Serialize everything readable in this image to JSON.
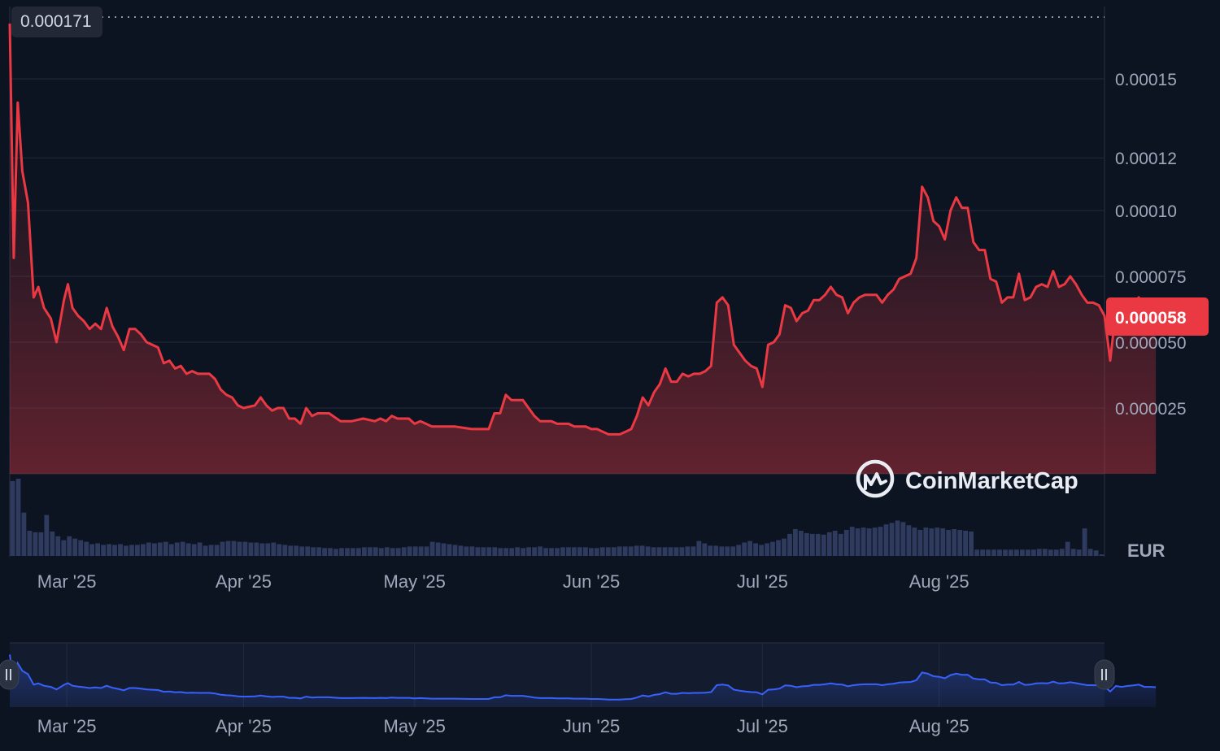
{
  "currency": "EUR",
  "watermark": "CoinMarketCap",
  "high_label": "0.000171",
  "current_label": "0.000058",
  "colors": {
    "background": "#0d1421",
    "price_line": "#ea3943",
    "current_badge": "#ea3943",
    "volume_bar": "#2e3a5e",
    "navigator_line": "#3861fb",
    "grid": "#222a3a"
  },
  "chart_data": {
    "type": "line",
    "ylim": [
      0,
      0.000175
    ],
    "y_ticks": [
      {
        "value": 2.5e-05,
        "label": "0.000025"
      },
      {
        "value": 5e-05,
        "label": "0.000050"
      },
      {
        "value": 7.5e-05,
        "label": "0.000075"
      },
      {
        "value": 0.0001,
        "label": "0.00010"
      },
      {
        "value": 0.00012,
        "label": "0.00012"
      },
      {
        "value": 0.00015,
        "label": "0.00015"
      }
    ],
    "x_ticks": [
      {
        "date": "2025-03-01",
        "label": "Mar '25"
      },
      {
        "date": "2025-04-01",
        "label": "Apr '25"
      },
      {
        "date": "2025-05-01",
        "label": "May '25"
      },
      {
        "date": "2025-06-01",
        "label": "Jun '25"
      },
      {
        "date": "2025-07-01",
        "label": "Jul '25"
      },
      {
        "date": "2025-08-01",
        "label": "Aug '25"
      }
    ],
    "start_date": "2025-02-19",
    "end_date": "2025-08-30",
    "series": [
      {
        "values": [
          [
            0,
            0.000171
          ],
          [
            0.7,
            8.2e-05
          ],
          [
            1.4,
            0.000141
          ],
          [
            2.2,
            0.000115
          ],
          [
            3.2,
            0.000103
          ],
          [
            4.2,
            6.7e-05
          ],
          [
            5,
            7.1e-05
          ],
          [
            6,
            6.3e-05
          ],
          [
            7.2,
            5.9e-05
          ],
          [
            8.2,
            5e-05
          ],
          [
            9.5,
            6.6e-05
          ],
          [
            10.2,
            7.2e-05
          ],
          [
            11,
            6.3e-05
          ],
          [
            12,
            6e-05
          ],
          [
            13,
            5.8e-05
          ],
          [
            14,
            5.5e-05
          ],
          [
            15,
            5.7e-05
          ],
          [
            16,
            5.5e-05
          ],
          [
            17,
            6.3e-05
          ],
          [
            18,
            5.6e-05
          ],
          [
            19,
            5.2e-05
          ],
          [
            20,
            4.7e-05
          ],
          [
            21,
            5.5e-05
          ],
          [
            22,
            5.5e-05
          ],
          [
            23,
            5.3e-05
          ],
          [
            24,
            5e-05
          ],
          [
            26,
            4.8e-05
          ],
          [
            27,
            4.2e-05
          ],
          [
            28,
            4.3e-05
          ],
          [
            29,
            4e-05
          ],
          [
            30,
            4.1e-05
          ],
          [
            31,
            3.8e-05
          ],
          [
            32,
            3.9e-05
          ],
          [
            33,
            3.8e-05
          ],
          [
            35,
            3.8e-05
          ],
          [
            36,
            3.6e-05
          ],
          [
            37,
            3.2e-05
          ],
          [
            38,
            3e-05
          ],
          [
            39,
            2.9e-05
          ],
          [
            40,
            2.6e-05
          ],
          [
            41,
            2.5e-05
          ],
          [
            43,
            2.6e-05
          ],
          [
            44,
            2.9e-05
          ],
          [
            45,
            2.6e-05
          ],
          [
            46,
            2.4e-05
          ],
          [
            47,
            2.5e-05
          ],
          [
            48,
            2.5e-05
          ],
          [
            49,
            2.1e-05
          ],
          [
            50,
            2.1e-05
          ],
          [
            51,
            1.9e-05
          ],
          [
            52,
            2.5e-05
          ],
          [
            53,
            2.2e-05
          ],
          [
            54,
            2.3e-05
          ],
          [
            56,
            2.3e-05
          ],
          [
            58,
            2e-05
          ],
          [
            60,
            2e-05
          ],
          [
            62,
            2.1e-05
          ],
          [
            64,
            2e-05
          ],
          [
            65,
            2.1e-05
          ],
          [
            66,
            2e-05
          ],
          [
            67,
            2.2e-05
          ],
          [
            68,
            2.1e-05
          ],
          [
            69,
            2.1e-05
          ],
          [
            70,
            2.1e-05
          ],
          [
            71,
            1.9e-05
          ],
          [
            72,
            2e-05
          ],
          [
            73,
            1.9e-05
          ],
          [
            74,
            1.8e-05
          ],
          [
            78,
            1.8e-05
          ],
          [
            81,
            1.7e-05
          ],
          [
            82,
            1.7e-05
          ],
          [
            84,
            1.7e-05
          ],
          [
            85,
            2.3e-05
          ],
          [
            86,
            2.3e-05
          ],
          [
            87,
            3e-05
          ],
          [
            88,
            2.8e-05
          ],
          [
            89,
            2.8e-05
          ],
          [
            90,
            2.8e-05
          ],
          [
            91,
            2.5e-05
          ],
          [
            92,
            2.2e-05
          ],
          [
            93,
            2e-05
          ],
          [
            94,
            2e-05
          ],
          [
            95,
            2e-05
          ],
          [
            96,
            1.9e-05
          ],
          [
            97,
            1.9e-05
          ],
          [
            98,
            1.9e-05
          ],
          [
            99,
            1.8e-05
          ],
          [
            100,
            1.8e-05
          ],
          [
            101,
            1.8e-05
          ],
          [
            102,
            1.7e-05
          ],
          [
            103,
            1.7e-05
          ],
          [
            104,
            1.6e-05
          ],
          [
            105,
            1.5e-05
          ],
          [
            106,
            1.5e-05
          ],
          [
            107,
            1.5e-05
          ],
          [
            108,
            1.6e-05
          ],
          [
            109,
            1.7e-05
          ],
          [
            110,
            2.2e-05
          ],
          [
            111,
            2.9e-05
          ],
          [
            112,
            2.6e-05
          ],
          [
            113,
            3.1e-05
          ],
          [
            114,
            3.4e-05
          ],
          [
            115,
            4e-05
          ],
          [
            116,
            3.5e-05
          ],
          [
            117,
            3.5e-05
          ],
          [
            118,
            3.8e-05
          ],
          [
            119,
            3.7e-05
          ],
          [
            120,
            3.8e-05
          ],
          [
            121,
            3.8e-05
          ],
          [
            122,
            3.9e-05
          ],
          [
            123,
            4.1e-05
          ],
          [
            124,
            6.5e-05
          ],
          [
            125,
            6.7e-05
          ],
          [
            126,
            6.4e-05
          ],
          [
            127,
            4.9e-05
          ],
          [
            128,
            4.6e-05
          ],
          [
            129,
            4.3e-05
          ],
          [
            130,
            4.1e-05
          ],
          [
            131,
            4e-05
          ],
          [
            132,
            3.3e-05
          ],
          [
            133,
            4.9e-05
          ],
          [
            134,
            5e-05
          ],
          [
            135,
            5.3e-05
          ],
          [
            136,
            6.4e-05
          ],
          [
            137,
            6.3e-05
          ],
          [
            138,
            5.8e-05
          ],
          [
            139,
            6.1e-05
          ],
          [
            140,
            6.2e-05
          ],
          [
            141,
            6.6e-05
          ],
          [
            142,
            6.6e-05
          ],
          [
            143,
            6.8e-05
          ],
          [
            144,
            7.1e-05
          ],
          [
            145,
            6.8e-05
          ],
          [
            146,
            6.7e-05
          ],
          [
            147,
            6.1e-05
          ],
          [
            148,
            6.5e-05
          ],
          [
            149,
            6.7e-05
          ],
          [
            150,
            6.8e-05
          ],
          [
            151,
            6.8e-05
          ],
          [
            152,
            6.8e-05
          ],
          [
            153,
            6.5e-05
          ],
          [
            154,
            6.8e-05
          ],
          [
            155,
            7e-05
          ],
          [
            156,
            7.4e-05
          ],
          [
            157,
            7.5e-05
          ],
          [
            158,
            7.6e-05
          ],
          [
            159,
            8.2e-05
          ],
          [
            160,
            0.000109
          ],
          [
            161,
            0.000105
          ],
          [
            162,
            9.6e-05
          ],
          [
            163,
            9.4e-05
          ],
          [
            164,
            8.9e-05
          ],
          [
            165,
            0.0001
          ],
          [
            166,
            0.000105
          ],
          [
            167,
            0.000101
          ],
          [
            168,
            0.000101
          ],
          [
            169,
            8.8e-05
          ],
          [
            170,
            8.5e-05
          ],
          [
            171,
            8.5e-05
          ],
          [
            172,
            7.4e-05
          ],
          [
            173,
            7.3e-05
          ],
          [
            174,
            6.5e-05
          ],
          [
            175,
            6.7e-05
          ],
          [
            176,
            6.7e-05
          ],
          [
            177,
            7.6e-05
          ],
          [
            178,
            6.6e-05
          ],
          [
            179,
            6.7e-05
          ],
          [
            180,
            7.1e-05
          ],
          [
            181,
            7.2e-05
          ],
          [
            182,
            7.1e-05
          ],
          [
            183,
            7.7e-05
          ],
          [
            184,
            7.1e-05
          ],
          [
            185,
            7.2e-05
          ],
          [
            186,
            7.5e-05
          ],
          [
            187,
            7.2e-05
          ],
          [
            188,
            6.8e-05
          ],
          [
            189,
            6.5e-05
          ],
          [
            190,
            6.5e-05
          ],
          [
            191,
            6.4e-05
          ],
          [
            192,
            6e-05
          ],
          [
            193,
            4.3e-05
          ],
          [
            194,
            6.2e-05
          ],
          [
            195,
            5.9e-05
          ],
          [
            196,
            6.2e-05
          ],
          [
            197,
            6.4e-05
          ],
          [
            198,
            6.7e-05
          ],
          [
            199,
            5.9e-05
          ],
          [
            200,
            5.9e-05
          ],
          [
            201,
            5.8e-05
          ]
        ]
      }
    ],
    "volume": [
      95,
      98,
      55,
      32,
      30,
      30,
      52,
      31,
      25,
      20,
      25,
      22,
      20,
      18,
      15,
      16,
      14,
      15,
      14,
      15,
      13,
      14,
      14,
      15,
      17,
      16,
      17,
      18,
      15,
      17,
      18,
      16,
      15,
      17,
      13,
      14,
      14,
      18,
      19,
      19,
      18,
      18,
      17,
      17,
      16,
      16,
      17,
      15,
      14,
      13,
      13,
      12,
      12,
      11,
      11,
      10,
      10,
      9,
      10,
      10,
      10,
      10,
      11,
      11,
      11,
      10,
      11,
      10,
      10,
      11,
      12,
      12,
      12,
      12,
      18,
      17,
      16,
      15,
      14,
      13,
      12,
      12,
      11,
      11,
      11,
      11,
      10,
      10,
      10,
      11,
      10,
      11,
      11,
      12,
      10,
      10,
      10,
      11,
      11,
      11,
      11,
      11,
      10,
      10,
      11,
      11,
      11,
      12,
      12,
      12,
      13,
      13,
      12,
      11,
      11,
      11,
      11,
      11,
      11,
      12,
      12,
      19,
      16,
      13,
      13,
      12,
      12,
      12,
      14,
      17,
      19,
      16,
      14,
      16,
      18,
      20,
      22,
      28,
      34,
      32,
      29,
      28,
      28,
      27,
      30,
      32,
      28,
      33,
      37,
      35,
      36,
      35,
      36,
      37,
      40,
      42,
      45,
      43,
      39,
      36,
      33,
      36,
      35,
      36,
      35,
      33,
      34,
      33,
      32,
      31,
      8,
      8,
      8,
      8,
      8,
      8,
      8,
      8,
      8,
      8,
      8,
      9,
      9,
      8,
      8,
      9,
      18,
      9,
      8,
      35,
      9,
      7,
      2
    ]
  }
}
